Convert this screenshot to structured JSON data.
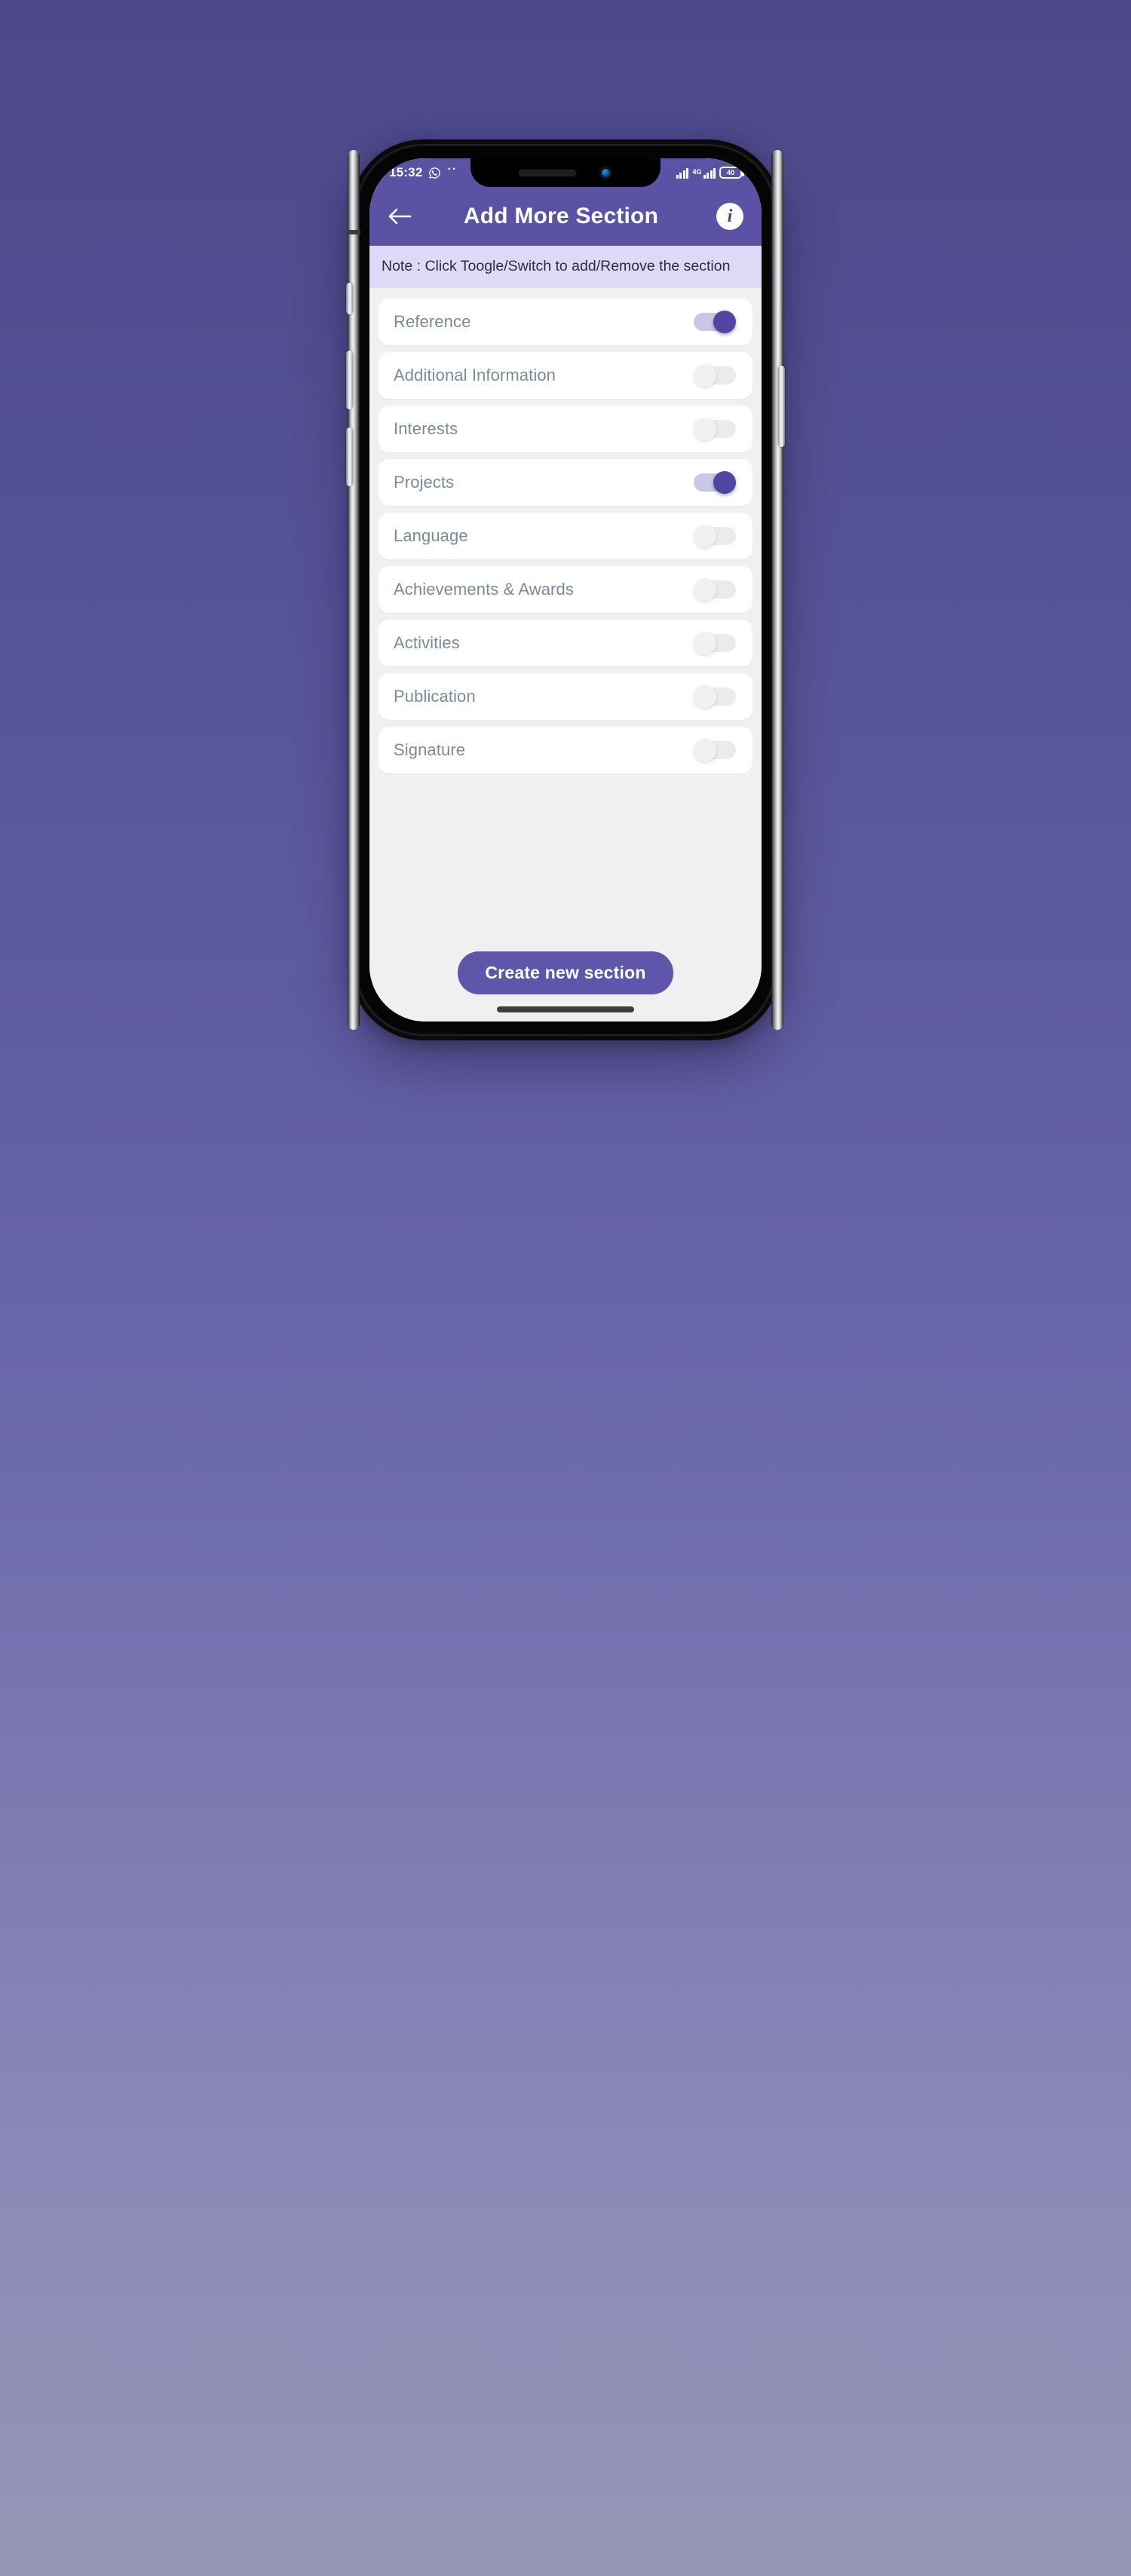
{
  "status_bar": {
    "time": "15:32",
    "whatsapp_icon": "whatsapp-icon",
    "more_dots": "··",
    "network_type": "4G",
    "battery_level": "40",
    "signal_icon": "signal-bars-icon"
  },
  "app_bar": {
    "back_icon": "back-arrow-icon",
    "title": "Add More Section",
    "info_icon": "info-icon",
    "info_glyph": "i"
  },
  "note": {
    "text": "Note : Click Toogle/Switch to add/Remove the section"
  },
  "sections": [
    {
      "label": "Reference",
      "enabled": true
    },
    {
      "label": "Additional Information",
      "enabled": false
    },
    {
      "label": "Interests",
      "enabled": false
    },
    {
      "label": "Projects",
      "enabled": true
    },
    {
      "label": "Language",
      "enabled": false
    },
    {
      "label": "Achievements & Awards",
      "enabled": false
    },
    {
      "label": "Activities",
      "enabled": false
    },
    {
      "label": "Publication",
      "enabled": false
    },
    {
      "label": "Signature",
      "enabled": false
    }
  ],
  "footer": {
    "create_button_label": "Create new section"
  },
  "colors": {
    "app_bar": "#5b52a6",
    "note_bg": "#ded9f7",
    "toggle_on_track": "#c9c6e8",
    "toggle_on_thumb": "#5145a3",
    "toggle_off_track": "#ebebeb",
    "toggle_off_thumb": "#f1f1f1",
    "label": "#7b8a99",
    "cta": "#5f56ac",
    "screen_bg": "#f0f0f0"
  }
}
